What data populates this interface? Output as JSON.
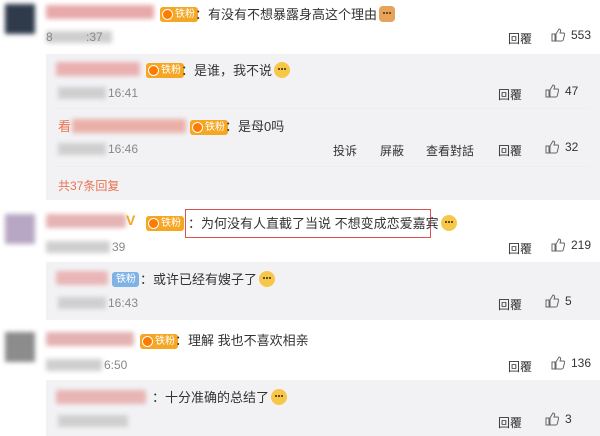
{
  "comments": [
    {
      "badge": "铁粉",
      "text": "：有没有不想暴露身高这个理由",
      "time": "8          :37",
      "reply": "回覆",
      "likes": "553"
    },
    {
      "badge": "铁粉",
      "text": "：为何没有人直截了当说 不想变成恋爱嘉宾",
      "time": "39",
      "reply": "回覆",
      "likes": "219"
    },
    {
      "badge": "铁粉",
      "text": "：理解 我也不喜欢相亲",
      "time": "6:50",
      "reply": "回覆",
      "likes": "136"
    }
  ],
  "replies": [
    {
      "badge": "铁粉",
      "text": "：是谁，我不说",
      "time": "16:41",
      "reply": "回覆",
      "likes": "47"
    },
    {
      "name_prefix": "看",
      "badge": "铁粉",
      "text": "：是母0吗",
      "time": "16:46",
      "actions": [
        "投诉",
        "屏蔽",
        "查看對話"
      ],
      "reply": "回覆",
      "likes": "32"
    },
    {
      "badge": "铁粉",
      "text": "：或许已经有嫂子了",
      "time": "16:43",
      "reply": "回覆",
      "likes": "5"
    },
    {
      "text": "：十分准确的总结了",
      "reply": "回覆",
      "likes": "3"
    }
  ],
  "more_replies": "共37条回复",
  "colors": {
    "link_orange": "#eb7350",
    "highlight_red": "#d9534f",
    "sub_bg": "#f2f2f5"
  },
  "icons": {
    "thumb": "thumbs-up-icon",
    "emoji": "smile-emoji-icon",
    "badge": "fan-badge-icon"
  }
}
